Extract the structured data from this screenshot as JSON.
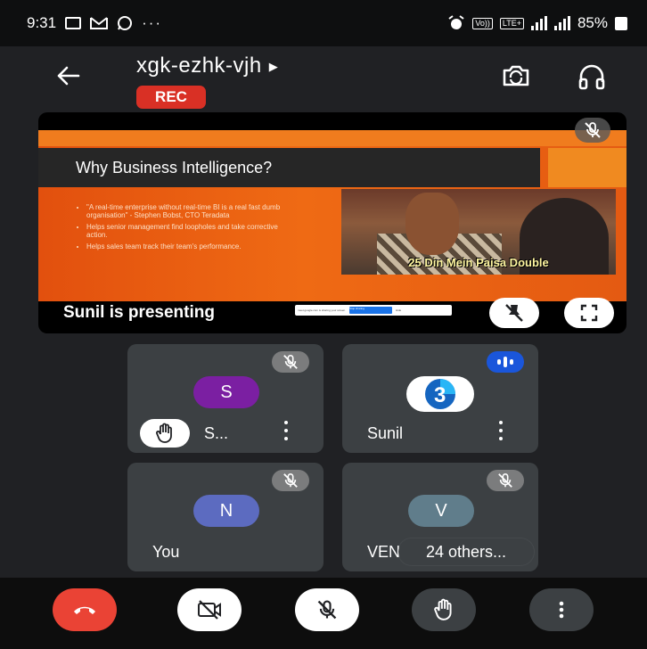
{
  "status_bar": {
    "time": "9:31",
    "notification_icons": [
      "image-icon",
      "gmail-icon",
      "whatsapp-icon"
    ],
    "more": "···",
    "volte": "Vo))",
    "lte": "LTE",
    "lte_plus": "LTE+",
    "battery": "85%"
  },
  "header": {
    "meeting_code": "xgk-ezhk-vjh",
    "rec_label": "REC"
  },
  "presentation": {
    "slide": {
      "title": "Why Business Intelligence?",
      "bullets": [
        "\"A real-time enterprise without real-time BI is a real fast dumb organisation\" - Stephen Bobst, CTO Teradata",
        "Helps senior management find loopholes and take corrective action.",
        "Helps sales team track their team's performance."
      ],
      "meme_caption": "25 Din Mein Paisa Double",
      "share_bar_text": "meet.google.com is sharing your screen.",
      "share_bar_stop": "Stop sharing",
      "share_bar_hide": "Hide"
    },
    "presenting_label": "Sunil is presenting"
  },
  "participants": [
    {
      "initial": "S",
      "name": "S...",
      "color": "#7b1fa2",
      "muted": true,
      "hand_raised": true
    },
    {
      "initial": "",
      "name": "Sunil",
      "speaking": true
    },
    {
      "initial": "N",
      "name": "You",
      "color": "#5c6bc0",
      "muted": true
    },
    {
      "initial": "V",
      "name": "VENKATA SW",
      "color": "#607d8b",
      "muted": true
    }
  ],
  "others_label": "24 others",
  "colors": {
    "background": "#202124",
    "tile": "#3c4043",
    "rec": "#d93025",
    "end_call": "#ea4335",
    "speaking_badge": "#1a56db",
    "slide_orange": "#e8580f"
  }
}
